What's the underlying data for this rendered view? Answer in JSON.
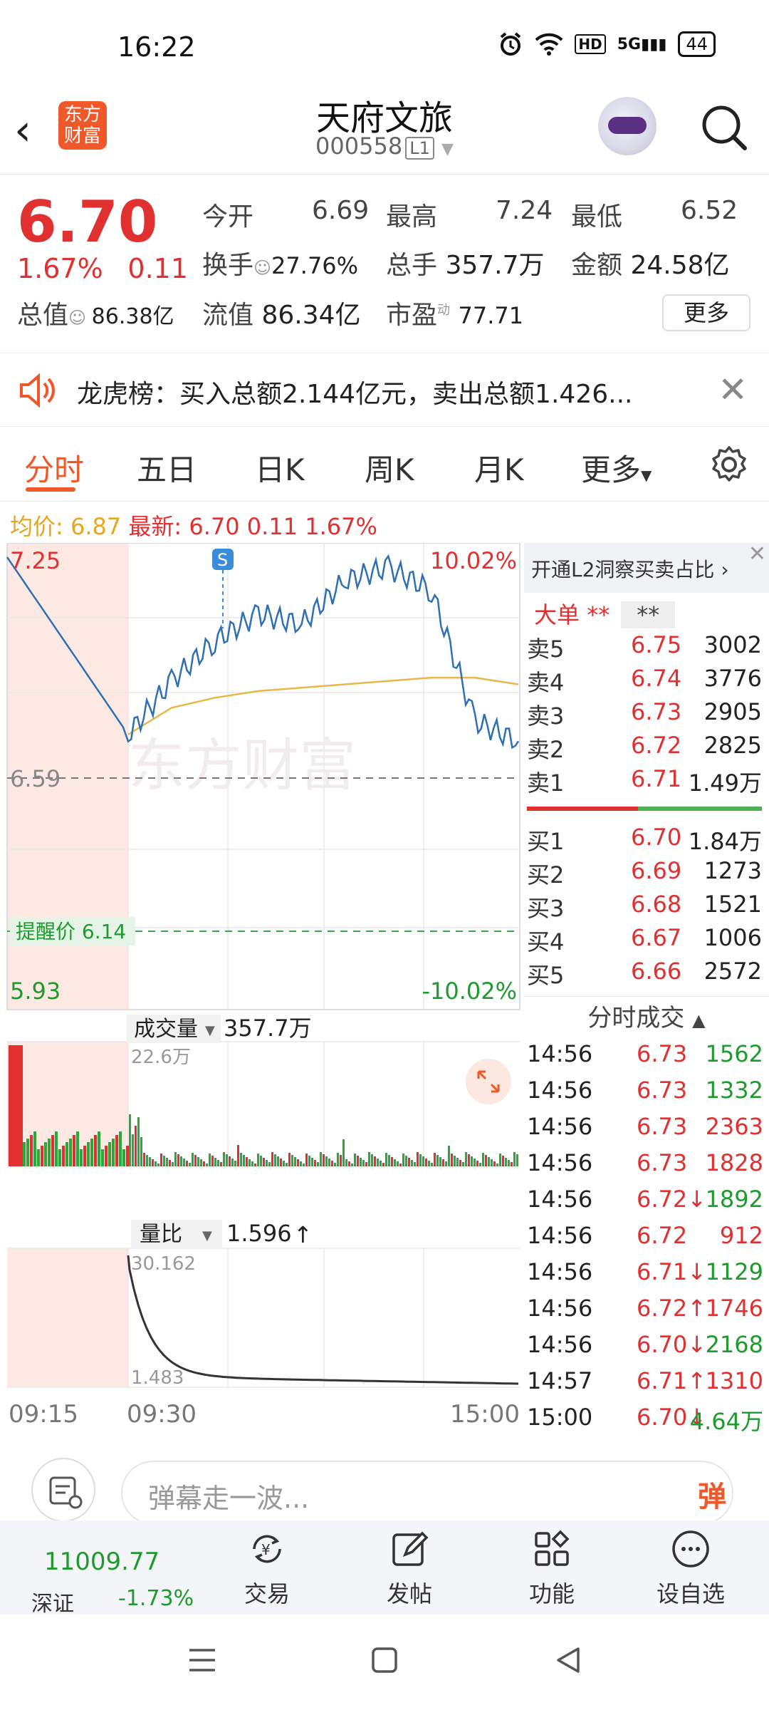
{
  "status_bar": {
    "time": "16:22",
    "battery": "44",
    "network": "5G",
    "hd": "HD"
  },
  "header": {
    "logo_text": "东方财富",
    "stock_name": "天府文旅",
    "stock_code": "000558",
    "level": "L1"
  },
  "quote": {
    "price": "6.70",
    "change_pct": "1.67%",
    "change_amt": "0.11",
    "open_label": "今开",
    "open": "6.69",
    "high_label": "最高",
    "high": "7.24",
    "low_label": "最低",
    "low": "6.52",
    "turnover_label": "换手",
    "turnover": "27.76%",
    "volume_label": "总手",
    "volume": "357.7万",
    "amount_label": "金额",
    "amount": "24.58亿",
    "total_mcap_label": "总值",
    "total_mcap": "86.38亿",
    "float_mcap_label": "流值",
    "float_mcap": "86.34亿",
    "pe_label": "市盈",
    "pe_sup": "动",
    "pe": "77.71",
    "more": "更多"
  },
  "notice": {
    "text": "龙虎榜：买入总额2.144亿元，卖出总额1.426..."
  },
  "tabs": [
    "分时",
    "五日",
    "日K",
    "周K",
    "月K",
    "更多"
  ],
  "avg_info": {
    "avg_label": "均价:",
    "avg": "6.87",
    "latest_label": "最新:",
    "latest": "6.70",
    "chg": "0.11",
    "pct": "1.67%"
  },
  "chart": {
    "y_top": "7.25",
    "y_mid": "6.59",
    "y_bottom": "5.93",
    "pct_top": "10.02%",
    "pct_bottom": "-10.02%",
    "alert_label": "提醒价 6.14",
    "signal_marker": "S",
    "watermark": "东方财富",
    "volume_label": "成交量",
    "volume_value": "357.7万",
    "volume_max": "22.6万",
    "ratio_label": "量比",
    "ratio_value": "1.596",
    "ratio_max": "30.162",
    "ratio_min": "1.483",
    "x_start": "09:15",
    "x_open": "09:30",
    "x_end": "15:00"
  },
  "chart_data": {
    "type": "line",
    "title": "",
    "xlabel": "",
    "ylabel": "",
    "ylim": [
      5.93,
      7.25
    ],
    "x": [
      "09:15",
      "09:30",
      "10:00",
      "10:30",
      "11:00",
      "11:30",
      "13:00",
      "13:30",
      "14:00",
      "14:30",
      "15:00"
    ],
    "series": [
      {
        "name": "",
        "values": [
          7.25,
          6.72,
          6.88,
          7.0,
          7.08,
          7.05,
          7.18,
          7.22,
          7.15,
          6.76,
          6.7
        ]
      },
      {
        "name": "",
        "values": [
          null,
          6.72,
          6.8,
          6.83,
          6.85,
          6.86,
          6.87,
          6.88,
          6.89,
          6.89,
          6.87
        ]
      }
    ],
    "reference_lines": {
      "prev_close": 6.59,
      "alert_price": 6.14
    }
  },
  "order_book": {
    "promo": "开通L2洞察买卖占比",
    "big_label": "大单",
    "big_mask_1": "**",
    "big_mask_2": "**",
    "asks": [
      {
        "label": "卖5",
        "price": "6.75",
        "vol": "3002"
      },
      {
        "label": "卖4",
        "price": "6.74",
        "vol": "3776"
      },
      {
        "label": "卖3",
        "price": "6.73",
        "vol": "2905"
      },
      {
        "label": "卖2",
        "price": "6.72",
        "vol": "2825"
      },
      {
        "label": "卖1",
        "price": "6.71",
        "vol": "1.49万"
      }
    ],
    "bids": [
      {
        "label": "买1",
        "price": "6.70",
        "vol": "1.84万"
      },
      {
        "label": "买2",
        "price": "6.69",
        "vol": "1273"
      },
      {
        "label": "买3",
        "price": "6.68",
        "vol": "1521"
      },
      {
        "label": "买4",
        "price": "6.67",
        "vol": "1006"
      },
      {
        "label": "买5",
        "price": "6.66",
        "vol": "2572"
      }
    ]
  },
  "ticks": {
    "title": "分时成交",
    "rows": [
      {
        "time": "14:56",
        "price": "6.73",
        "vol": "1562",
        "dir": "",
        "color": "#1f9a2e"
      },
      {
        "time": "14:56",
        "price": "6.73",
        "vol": "1332",
        "dir": "",
        "color": "#1f9a2e"
      },
      {
        "time": "14:56",
        "price": "6.73",
        "vol": "2363",
        "dir": "",
        "color": "#e03030"
      },
      {
        "time": "14:56",
        "price": "6.73",
        "vol": "1828",
        "dir": "",
        "color": "#e03030"
      },
      {
        "time": "14:56",
        "price": "6.72",
        "vol": "1892",
        "dir": "↓",
        "color": "#1f9a2e"
      },
      {
        "time": "14:56",
        "price": "6.72",
        "vol": "912",
        "dir": "",
        "color": "#e03030"
      },
      {
        "time": "14:56",
        "price": "6.71",
        "vol": "1129",
        "dir": "↓",
        "color": "#1f9a2e"
      },
      {
        "time": "14:56",
        "price": "6.72",
        "vol": "1746",
        "dir": "↑",
        "color": "#e03030"
      },
      {
        "time": "14:56",
        "price": "6.70",
        "vol": "2168",
        "dir": "↓",
        "color": "#1f9a2e"
      },
      {
        "time": "14:57",
        "price": "6.71",
        "vol": "1310",
        "dir": "↑",
        "color": "#e03030"
      },
      {
        "time": "15:00",
        "price": "6.70",
        "vol": "4.64万",
        "dir": "↓",
        "color": "#1f9a2e"
      }
    ]
  },
  "comment": {
    "placeholder": "弹幕走一波...",
    "dan": "弹"
  },
  "bottom": {
    "index_value": "11009.77",
    "index_name": "深证",
    "index_change": "-1.73%",
    "nav": [
      "交易",
      "发帖",
      "功能",
      "设自选"
    ]
  },
  "colors": {
    "up": "#e03030",
    "down": "#1f9a2e",
    "accent": "#f0582a",
    "avg_line": "#e6a620",
    "price_line": "#2f6fb3"
  }
}
